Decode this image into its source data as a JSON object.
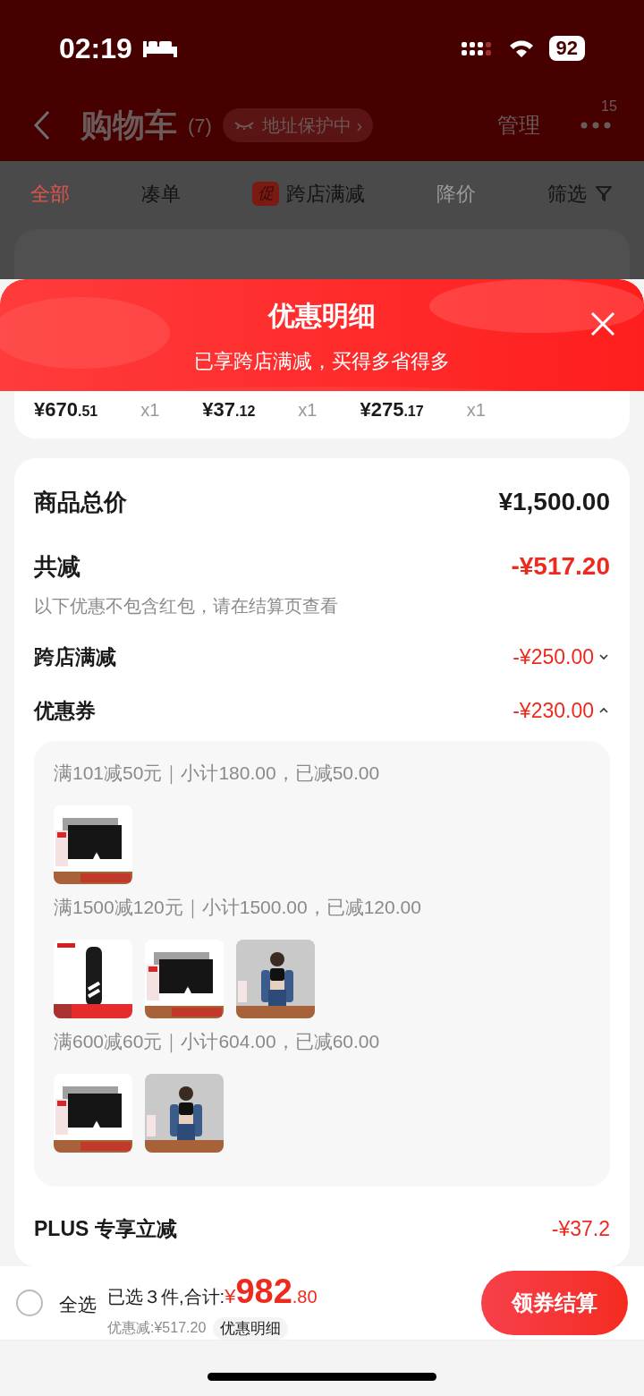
{
  "status_bar": {
    "time": "02:19",
    "battery": "92"
  },
  "nav": {
    "title": "购物车",
    "count": "(7)",
    "address_badge": "地址保护中 ›",
    "manage": "管理",
    "more_badge": "15"
  },
  "tabs": [
    {
      "label": "全部",
      "selected": true,
      "kind": "text"
    },
    {
      "label": "凑单",
      "selected": false,
      "kind": "text"
    },
    {
      "label": "跨店满减",
      "selected": false,
      "kind": "promo",
      "tag": "促"
    },
    {
      "label": "降价",
      "selected": false,
      "kind": "disabled"
    },
    {
      "label": "筛选",
      "selected": false,
      "kind": "filter"
    }
  ],
  "sheet": {
    "title": "优惠明细",
    "subtitle": "已享跨店满减，买得多省得多",
    "items": [
      {
        "price": "¥670",
        "cents": ".51",
        "qty": "x1"
      },
      {
        "price": "¥37",
        "cents": ".12",
        "qty": "x1"
      },
      {
        "price": "¥275",
        "cents": ".17",
        "qty": "x1"
      }
    ],
    "summary": {
      "total_label": "商品总价",
      "total": "¥1,500.00",
      "reduce_label": "共减",
      "reduce": "-¥517.20",
      "note": "以下优惠不包含红包，请在结算页查看",
      "discounts": [
        {
          "label": "跨店满减",
          "amount": "-¥250.00",
          "expanded": false
        },
        {
          "label": "优惠券",
          "amount": "-¥230.00",
          "expanded": true,
          "groups": [
            {
              "rule": "满101减50元｜小计180.00，已减50.00"
            },
            {
              "rule": "满1500减120元｜小计1500.00，已减120.00"
            },
            {
              "rule": "满600减60元｜小计604.00，已减60.00"
            }
          ]
        }
      ],
      "plus_label": "PLUS 专享立减",
      "plus_amount": "-¥37.2"
    }
  },
  "bottom_bar": {
    "select_all": {
      "label": "全选",
      "checked": false
    },
    "selected_text": "已选３件,合计:",
    "currency": "¥",
    "amount": "982",
    "cents": ".80",
    "discount_text": "优惠减:¥517.20",
    "detail_button": "优惠明细",
    "checkout": "领券结算"
  }
}
